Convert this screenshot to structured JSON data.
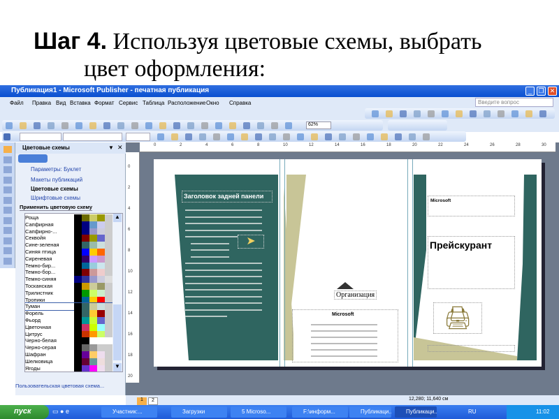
{
  "slide": {
    "title_bold": "Шаг 4.",
    "title_rest": " Используя цветовые схемы, выбрать",
    "title_line2": "цвет оформления:"
  },
  "window": {
    "title": "Публикация1 - Microsoft Publisher - печатная публикация",
    "help_placeholder": "Введите вопрос",
    "zoom": "62%"
  },
  "menu": [
    "Файл",
    "Правка",
    "Вид",
    "Вставка",
    "Формат",
    "Сервис",
    "Таблица",
    "Расположение",
    "Окно",
    "Справка"
  ],
  "pane": {
    "title": "Цветовые схемы",
    "links": [
      "Параметры: Буклет",
      "Макеты публикаций",
      "Цветовые схемы",
      "Шрифтовые схемы"
    ],
    "section": "Применить цветовую схему",
    "custom_link": "Пользовательская цветовая схема...",
    "selected": "Туман",
    "schemes": [
      {
        "name": "Роща",
        "colors": [
          "#000000",
          "#6b6b00",
          "#cccc66",
          "#999900",
          "#cccccc"
        ]
      },
      {
        "name": "Сапфирная",
        "colors": [
          "#000000",
          "#000080",
          "#6699cc",
          "#ccccee",
          "#cccccc"
        ]
      },
      {
        "name": "Сапфирно-...",
        "colors": [
          "#000000",
          "#000080",
          "#9999cc",
          "#ccccdd",
          "#cccccc"
        ]
      },
      {
        "name": "Секвойя",
        "colors": [
          "#000000",
          "#800000",
          "#999900",
          "#6666cc",
          "#cccccc"
        ]
      },
      {
        "name": "Сине-зеленая",
        "colors": [
          "#000000",
          "#336666",
          "#99bbaa",
          "#cce0dd",
          "#cccccc"
        ]
      },
      {
        "name": "Синяя птица",
        "colors": [
          "#000000",
          "#0000ff",
          "#ffcc00",
          "#ff6600",
          "#cccccc"
        ]
      },
      {
        "name": "Сиреневая",
        "colors": [
          "#000000",
          "#330066",
          "#cc99ff",
          "#cc99cc",
          "#cccccc"
        ]
      },
      {
        "name": "Темно-бир...",
        "colors": [
          "#000000",
          "#006699",
          "#99ccdd",
          "#cce6ee",
          "#cccccc"
        ]
      },
      {
        "name": "Темно-бор...",
        "colors": [
          "#000000",
          "#800000",
          "#cc9999",
          "#eecccc",
          "#cccccc"
        ]
      },
      {
        "name": "Темно-синяя",
        "colors": [
          "#000080",
          "#333399",
          "#9999cc",
          "#ccccdd",
          "#dddddd"
        ]
      },
      {
        "name": "Тосканская",
        "colors": [
          "#000000",
          "#cc9900",
          "#cccc99",
          "#999966",
          "#cccccc"
        ]
      },
      {
        "name": "Трилистник",
        "colors": [
          "#000000",
          "#009900",
          "#ccff66",
          "#cceecc",
          "#cccccc"
        ]
      },
      {
        "name": "Тропики",
        "colors": [
          "#000000",
          "#006699",
          "#ffcc00",
          "#ff0000",
          "#cccccc"
        ]
      },
      {
        "name": "Туман",
        "colors": [
          "#000000",
          "#336666",
          "#cccc99",
          "#ccdddd",
          "#cccccc"
        ]
      },
      {
        "name": "Форель",
        "colors": [
          "#000000",
          "#336666",
          "#ffcc33",
          "#990000",
          "#cccccc"
        ]
      },
      {
        "name": "Фьорд",
        "colors": [
          "#000000",
          "#009999",
          "#ccff33",
          "#6666cc",
          "#cccccc"
        ]
      },
      {
        "name": "Цветочная",
        "colors": [
          "#000000",
          "#cc3366",
          "#ccff00",
          "#99ffff",
          "#cccccc"
        ]
      },
      {
        "name": "Цитрус",
        "colors": [
          "#000000",
          "#cc3300",
          "#ff9900",
          "#ccff66",
          "#cccccc"
        ]
      },
      {
        "name": "Черно-белая",
        "colors": [
          "#000000",
          "#000000",
          "#ffffff",
          "#ffffff",
          "#ffffff"
        ]
      },
      {
        "name": "Черно-серая",
        "colors": [
          "#000000",
          "#666666",
          "#999999",
          "#cccccc",
          "#cccccc"
        ]
      },
      {
        "name": "Шафран",
        "colors": [
          "#000000",
          "#660099",
          "#ffcc66",
          "#eeddee",
          "#cccccc"
        ]
      },
      {
        "name": "Шелковица",
        "colors": [
          "#000000",
          "#660033",
          "#669999",
          "#eedddd",
          "#cccccc"
        ]
      },
      {
        "name": "Ягоды",
        "colors": [
          "#000000",
          "#6633cc",
          "#ff00ff",
          "#eeddee",
          "#cccccc"
        ]
      }
    ]
  },
  "rulers": {
    "top": [
      "0",
      "2",
      "4",
      "6",
      "8",
      "10",
      "12",
      "14",
      "16",
      "18",
      "20",
      "22",
      "24",
      "26",
      "28",
      "30"
    ],
    "left": [
      "0",
      "2",
      "4",
      "6",
      "8",
      "10",
      "12",
      "14",
      "16",
      "18",
      "20"
    ]
  },
  "brochure": {
    "accent": "#2f6560",
    "secondary": "#c8c597",
    "back_title": "Заголовок задней панели",
    "org": "Организация",
    "company": "Microsoft",
    "company2": "Microsoft",
    "price": "Прейскурант"
  },
  "status": {
    "coords": "12,280; 11,640 см",
    "pages": [
      "1",
      "2"
    ]
  },
  "taskbar": {
    "start": "пуск",
    "tasks": [
      "Участник:...",
      "Загрузки",
      "5 Microso...",
      "F:\\информ...",
      "Публикаци...",
      "Публикаци..."
    ],
    "lang": "RU",
    "clock": "11:02"
  }
}
